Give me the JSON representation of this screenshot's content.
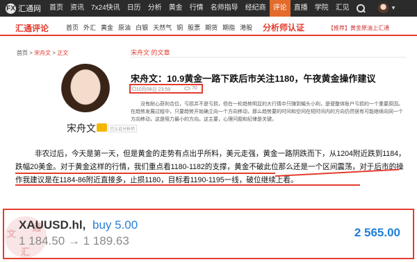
{
  "site": {
    "logo_text": "汇通网",
    "logo_mark": "FX"
  },
  "top_nav": {
    "items": [
      {
        "label": "首页",
        "active": false
      },
      {
        "label": "资讯",
        "active": false
      },
      {
        "label": "7x24快讯",
        "active": false
      },
      {
        "label": "日历",
        "active": false
      },
      {
        "label": "分析",
        "active": false
      },
      {
        "label": "黄金",
        "active": false
      },
      {
        "label": "行情",
        "active": false
      },
      {
        "label": "名师指导",
        "active": false
      },
      {
        "label": "经纪商",
        "active": false
      },
      {
        "label": "评论",
        "active": true
      },
      {
        "label": "直播",
        "active": false
      },
      {
        "label": "学院",
        "active": false
      },
      {
        "label": "汇见",
        "active": false
      }
    ]
  },
  "sub_bar": {
    "brand": "汇通评论",
    "items": [
      "首页",
      "外汇",
      "黄金",
      "原油",
      "白银",
      "天然气",
      "铜",
      "股票",
      "期货",
      "期指",
      "港股"
    ],
    "analyst_link": "分析师认证",
    "promo": "【推荐】黄金原油上汇通"
  },
  "breadcrumb": {
    "home": "首页",
    "author": "宋舟文",
    "current": "正文",
    "sep": " > "
  },
  "author": {
    "name": "宋舟文",
    "flag": "已认证分析师"
  },
  "article": {
    "section_header": "宋舟文 的文章",
    "title": "宋舟文：10.9黄金一路下跌后市关注1180，午夜黄金操作建议",
    "date": "10月08日 23:59",
    "views": "70",
    "summary": "没有耐心获利合位，亏损并不是亏损，但在一轮趋势明显的大行情中只赚到蝇头小利，是便整体账户亏损的一个重要原因。在趋势发展过程中，只要趋势开始确立向一个方向移动，那么趋势要的时间和空间在短时间内的方向仍然很有可能继续向同一个方向移动，这是阻力最小的方向。这主要，心理问题和纪律是关键。",
    "body": "非农过后，今天是第一天，但是黄金的走势有点出乎所料，美元走强，黄金一路阴跌而下，从1204附近跌到1184，跌幅20美金。对于黄金这样的行情，我们重点看1180-1182的支撑，黄金不破此位那么还是一个区间震荡，对于后市的操作我建议是在1184-86附近直接多，止损1180，目标看1190-1195一线，破位继续上看。"
  },
  "quote": {
    "symbol": "XAUUSD.hl,",
    "action": "buy 5.00",
    "range": "1 184.50 → 1 189.63",
    "price": "2 565.00",
    "seal_chars": [
      "文",
      "通",
      "汇"
    ]
  },
  "colors": {
    "accent": "#e33b2e",
    "nav_bg": "#2b2b2b",
    "nav_active": "#e36b2c",
    "quote_blue": "#1f7fd8"
  }
}
